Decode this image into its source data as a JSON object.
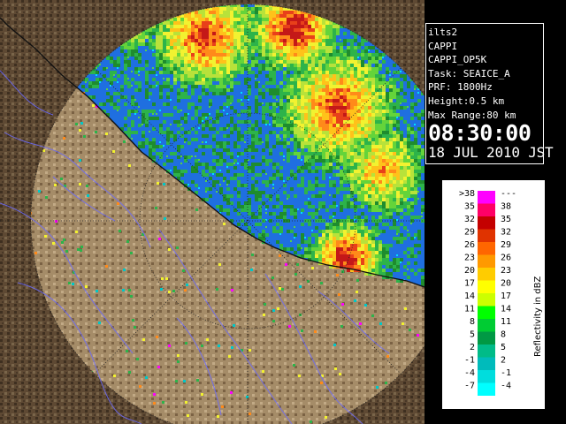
{
  "radar": {
    "rings": 2,
    "colors": {
      "ocean": "#1f6fe0",
      "ocean_light": "#3da2ff",
      "terrain_dark": "#4a3a27",
      "terrain_mid": "#7b6244",
      "terrain_light": "#a58c68",
      "coast": "#1a1a1a",
      "rivers": "#6a6aff",
      "grid": "#2b2b2b"
    }
  },
  "info": {
    "station": "ilts2",
    "product": "CAPPI",
    "product_code": "CAPPI_OP5K",
    "task": "Task: SEAICE_A",
    "prf": "PRF: 1800Hz",
    "height": "Height:0.5 km",
    "max_range": "Max Range:80 km",
    "time": "08:30:00",
    "date": "18 JUL 2010 JST"
  },
  "legend": {
    "title": "Reflectivity in dBZ",
    "rows": [
      {
        "low": ">38",
        "high": "---",
        "color": "#ff00ff"
      },
      {
        "low": "35",
        "high": "38",
        "color": "#ff0066"
      },
      {
        "low": "32",
        "high": "35",
        "color": "#c40000"
      },
      {
        "low": "29",
        "high": "32",
        "color": "#e03300"
      },
      {
        "low": "26",
        "high": "29",
        "color": "#ff6600"
      },
      {
        "low": "23",
        "high": "26",
        "color": "#ff9900"
      },
      {
        "low": "20",
        "high": "23",
        "color": "#ffcc00"
      },
      {
        "low": "17",
        "high": "20",
        "color": "#ffff00"
      },
      {
        "low": "14",
        "high": "17",
        "color": "#ccff00"
      },
      {
        "low": "11",
        "high": "14",
        "color": "#00ff00"
      },
      {
        "low": "8",
        "high": "11",
        "color": "#00cc33"
      },
      {
        "low": "5",
        "high": "8",
        "color": "#009944"
      },
      {
        "low": "2",
        "high": "5",
        "color": "#00bb88"
      },
      {
        "low": "-1",
        "high": "2",
        "color": "#00bbbb"
      },
      {
        "low": "-4",
        "high": "-1",
        "color": "#00dddd"
      },
      {
        "low": "-7",
        "high": "-4",
        "color": "#00ffff"
      }
    ]
  }
}
